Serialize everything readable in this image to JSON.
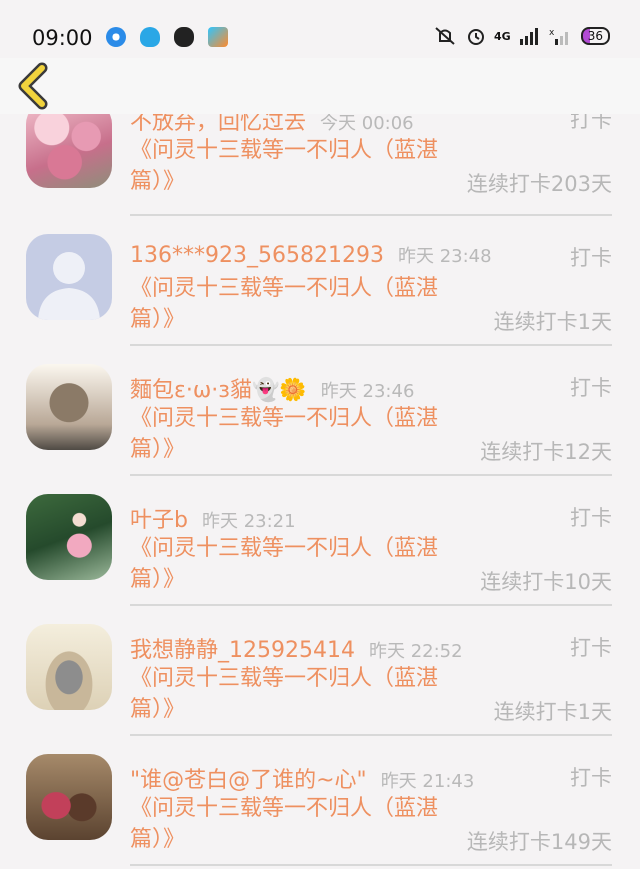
{
  "status_bar": {
    "time": "09:00",
    "network": "4G",
    "battery": "36"
  },
  "header": {
    "back_icon": "chevron-left-icon",
    "accent": "#f1d33d"
  },
  "colors": {
    "name": "#ee9060",
    "muted": "#b7b7b7",
    "background": "#f5f3f4"
  },
  "entries": [
    {
      "name": "不放弃，回忆过去",
      "time": "今天 00:06",
      "action": "打卡",
      "title": "《问灵十三载等一不归人（蓝湛篇）》",
      "streak": "连续打卡203天"
    },
    {
      "name": "136***923_565821293",
      "time": "昨天 23:48",
      "action": "打卡",
      "title": "《问灵十三载等一不归人（蓝湛篇）》",
      "streak": "连续打卡1天"
    },
    {
      "name": "麵包ε·ω·з貓👻🌼",
      "time": "昨天 23:46",
      "action": "打卡",
      "title": "《问灵十三载等一不归人（蓝湛篇）》",
      "streak": "连续打卡12天"
    },
    {
      "name": "叶子b",
      "time": "昨天 23:21",
      "action": "打卡",
      "title": "《问灵十三载等一不归人（蓝湛篇）》",
      "streak": "连续打卡10天"
    },
    {
      "name": "我想静静_125925414",
      "time": "昨天 22:52",
      "action": "打卡",
      "title": "《问灵十三载等一不归人（蓝湛篇）》",
      "streak": "连续打卡1天"
    },
    {
      "name": "\"谁@苍白@了谁的~心\"",
      "time": "昨天 21:43",
      "action": "打卡",
      "title": "《问灵十三载等一不归人（蓝湛篇）》",
      "streak": "连续打卡149天"
    }
  ]
}
